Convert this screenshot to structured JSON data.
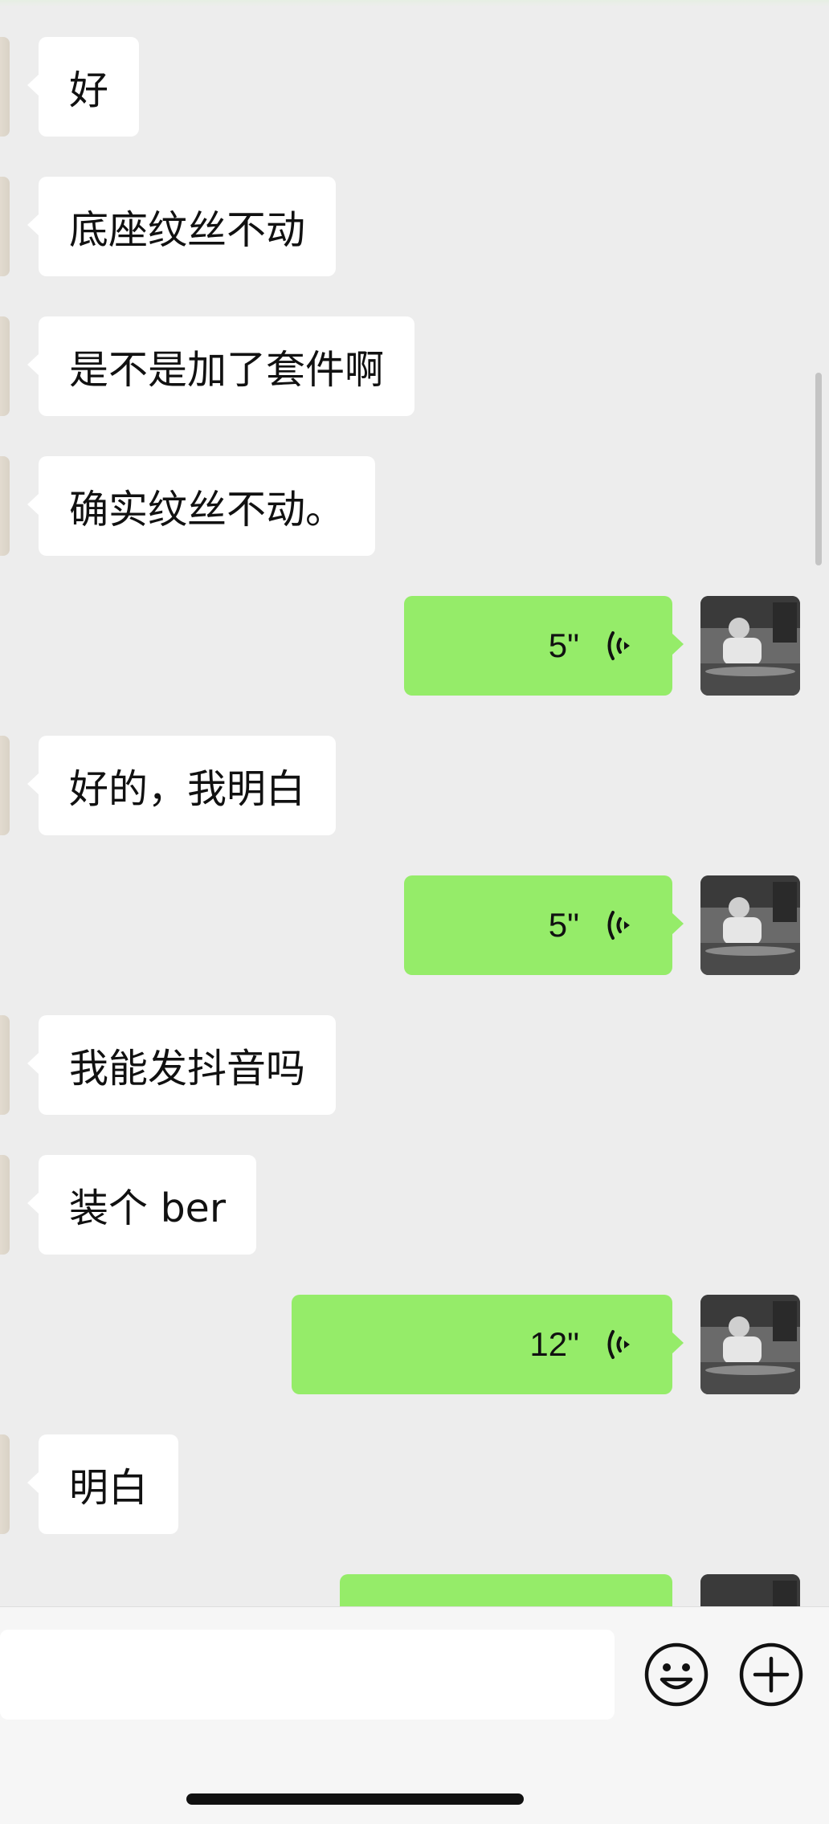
{
  "messages": [
    {
      "side": "left",
      "text": "好"
    },
    {
      "side": "left",
      "text": "底座纹丝不动"
    },
    {
      "side": "left",
      "text": "是不是加了套件啊"
    },
    {
      "side": "left",
      "text": "确实纹丝不动。"
    },
    {
      "side": "right",
      "type": "voice",
      "duration": "5\""
    },
    {
      "side": "left",
      "text": "好的，我明白"
    },
    {
      "side": "right",
      "type": "voice",
      "duration": "5\""
    },
    {
      "side": "left",
      "text": "我能发抖音吗"
    },
    {
      "side": "left",
      "text": "装个 ber"
    },
    {
      "side": "right",
      "type": "voice",
      "duration": "12\""
    },
    {
      "side": "left",
      "text": "明白"
    },
    {
      "side": "right",
      "type": "voice",
      "duration": ""
    }
  ],
  "input": {
    "placeholder": "",
    "value": ""
  },
  "icons": {
    "emoji": "emoji-icon",
    "plus": "plus-icon",
    "voice": "voice-wave-icon"
  },
  "colors": {
    "background": "#ededed",
    "sent_bubble": "#95ec69",
    "received_bubble": "#ffffff"
  }
}
